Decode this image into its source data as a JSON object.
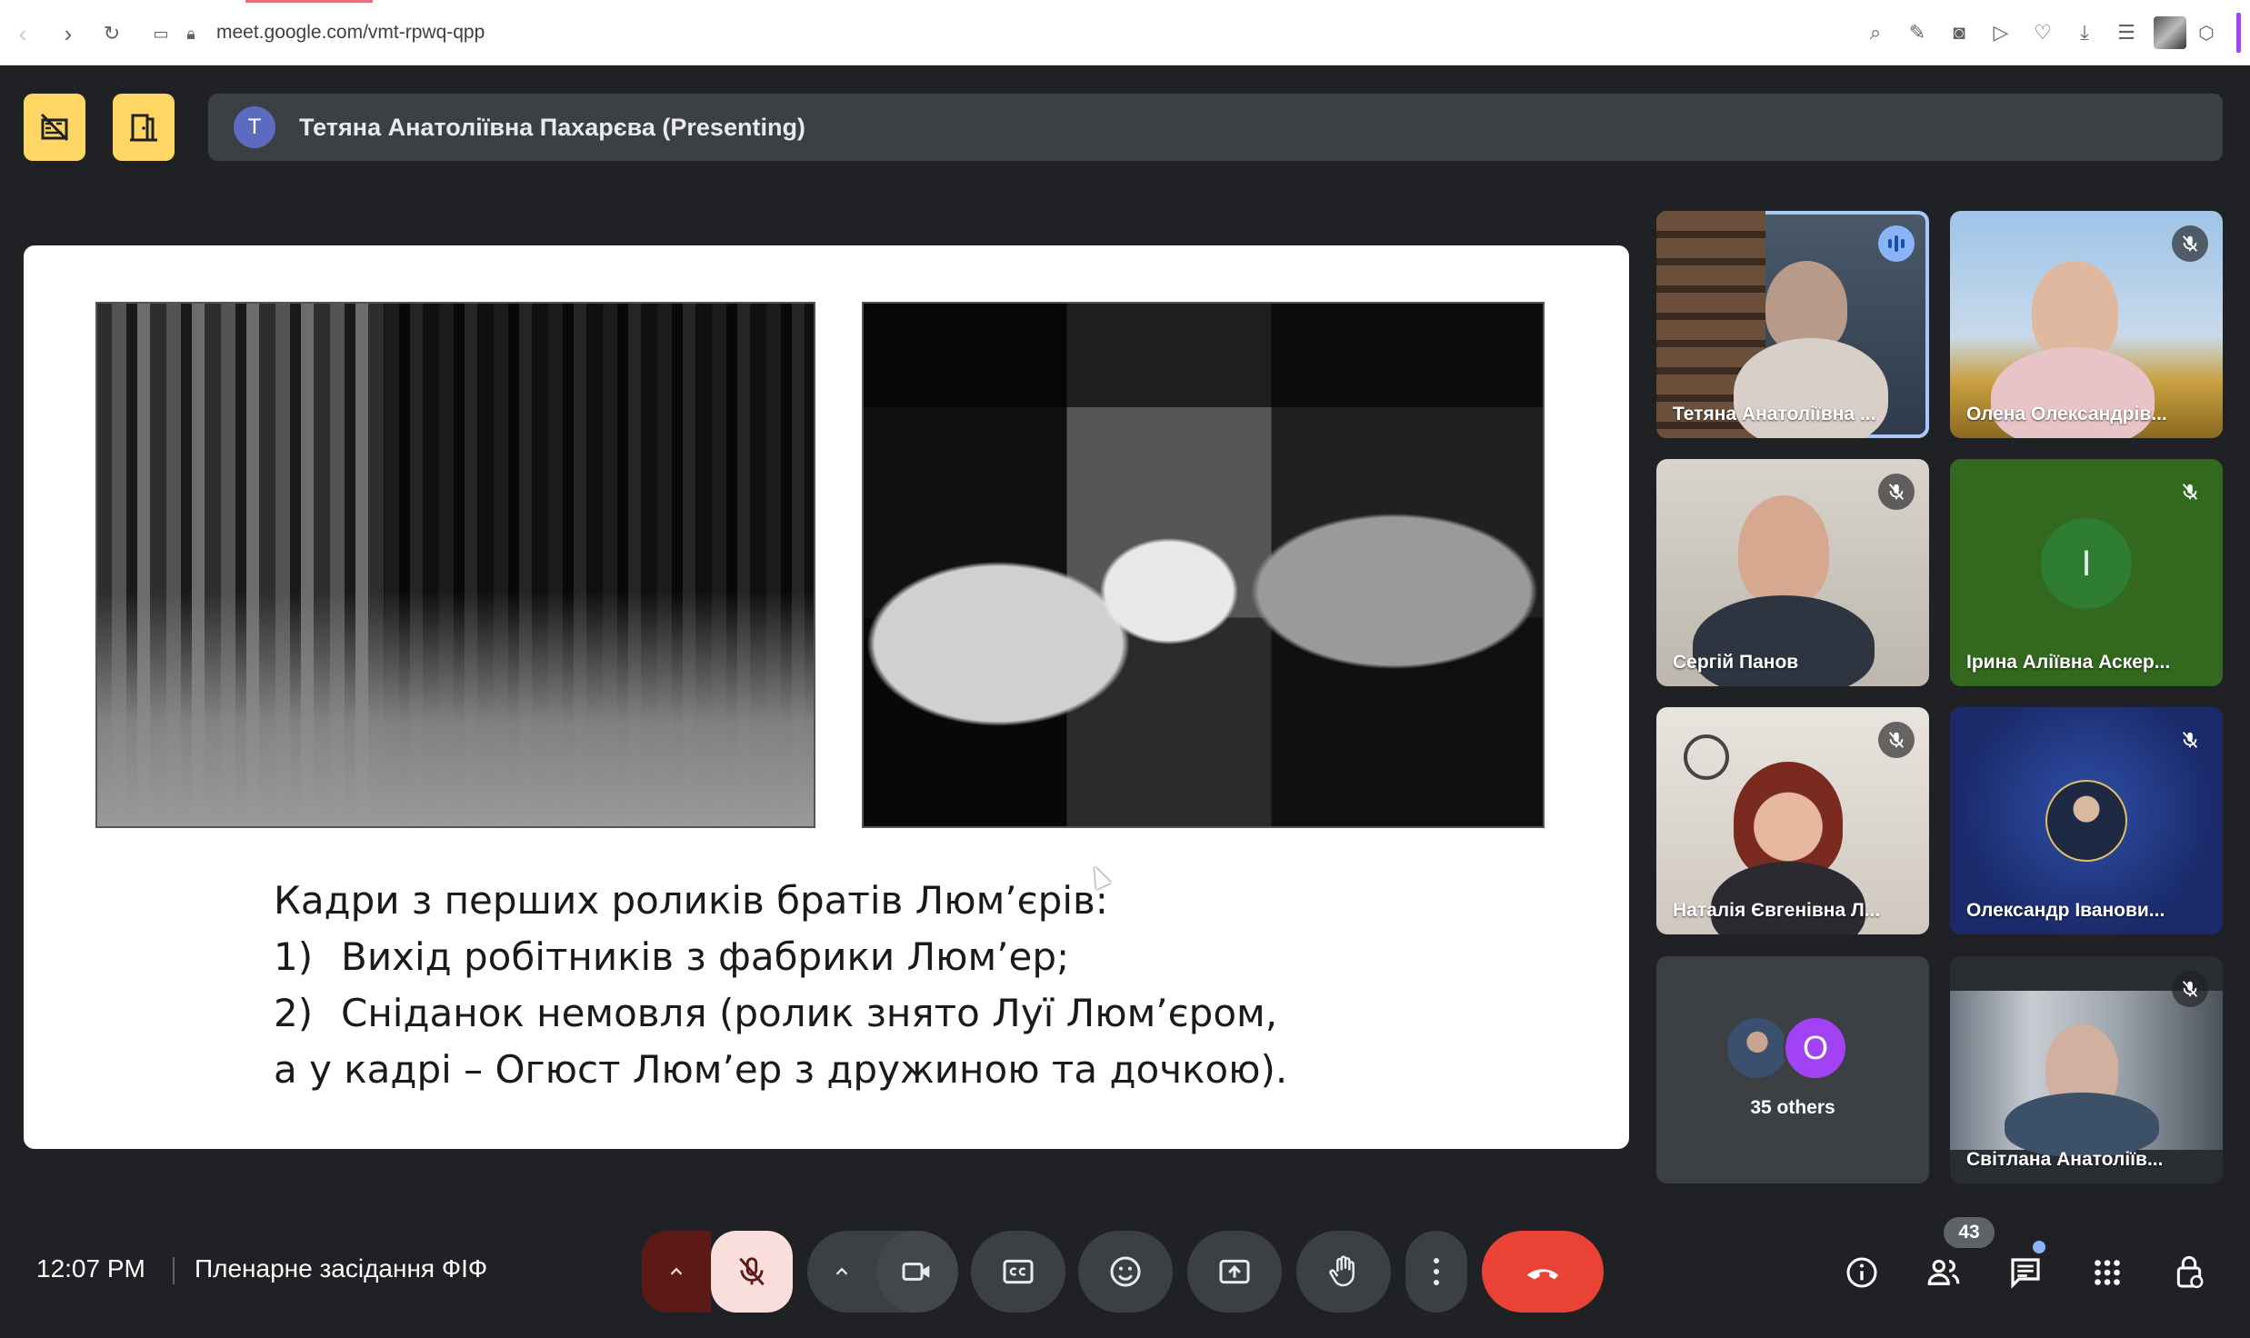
{
  "browser": {
    "url": "meet.google.com/vmt-rpwq-qpp"
  },
  "presenter": {
    "initial": "T",
    "label": "Тетяна Анатоліївна Пахарєва (Presenting)"
  },
  "slide": {
    "lines": [
      "Кадри з перших роликів братів Люм’єрів:",
      "Вихід робітників з фабрики Люм’ер;",
      "Сніданок немовля (ролик знято Луї Люм’єром,",
      "а у кадрі – Огюст Люм’ер з дружиною та дочкою)."
    ],
    "numbers": [
      "1)",
      "2)"
    ]
  },
  "participants": [
    {
      "name": "Тетяна Анатоліївна ...",
      "status": "speaking"
    },
    {
      "name": "Олена Олександрів...",
      "status": "muted"
    },
    {
      "name": "Сергій Панов",
      "status": "muted"
    },
    {
      "name": "Ірина Аліївна Аскер...",
      "status": "muted",
      "initial": "І"
    },
    {
      "name": "Наталія Євгенівна Л...",
      "status": "muted"
    },
    {
      "name": "Олександр Іванови...",
      "status": "muted"
    },
    {
      "name": "Світлана Анатоліїв...",
      "status": "muted"
    }
  ],
  "others": {
    "initial": "O",
    "label": "35 others"
  },
  "bottom": {
    "time": "12:07 PM",
    "meeting_title": "Пленарне засідання ФІФ",
    "people_count": "43"
  },
  "colors": {
    "accent_yellow": "#fdd663",
    "end_call": "#ea4335",
    "mic_off_bg": "#f9dedc",
    "mic_off_dark": "#5c1a17",
    "speaking": "#8ab4f8"
  },
  "icons": [
    "arrow-left-icon",
    "arrow-right-icon",
    "reload-icon",
    "site-info-icon",
    "lock-icon",
    "search-icon",
    "edit-icon",
    "camera-icon",
    "send-icon",
    "heart-icon",
    "download-icon",
    "menu-icon",
    "cube-icon",
    "camera-off-icon",
    "door-icon",
    "mic-off-icon",
    "chevron-up-icon",
    "video-icon",
    "captions-icon",
    "emoji-icon",
    "present-icon",
    "raise-hand-icon",
    "more-vert-icon",
    "end-call-icon",
    "info-icon",
    "people-icon",
    "chat-icon",
    "apps-icon",
    "host-controls-icon"
  ]
}
